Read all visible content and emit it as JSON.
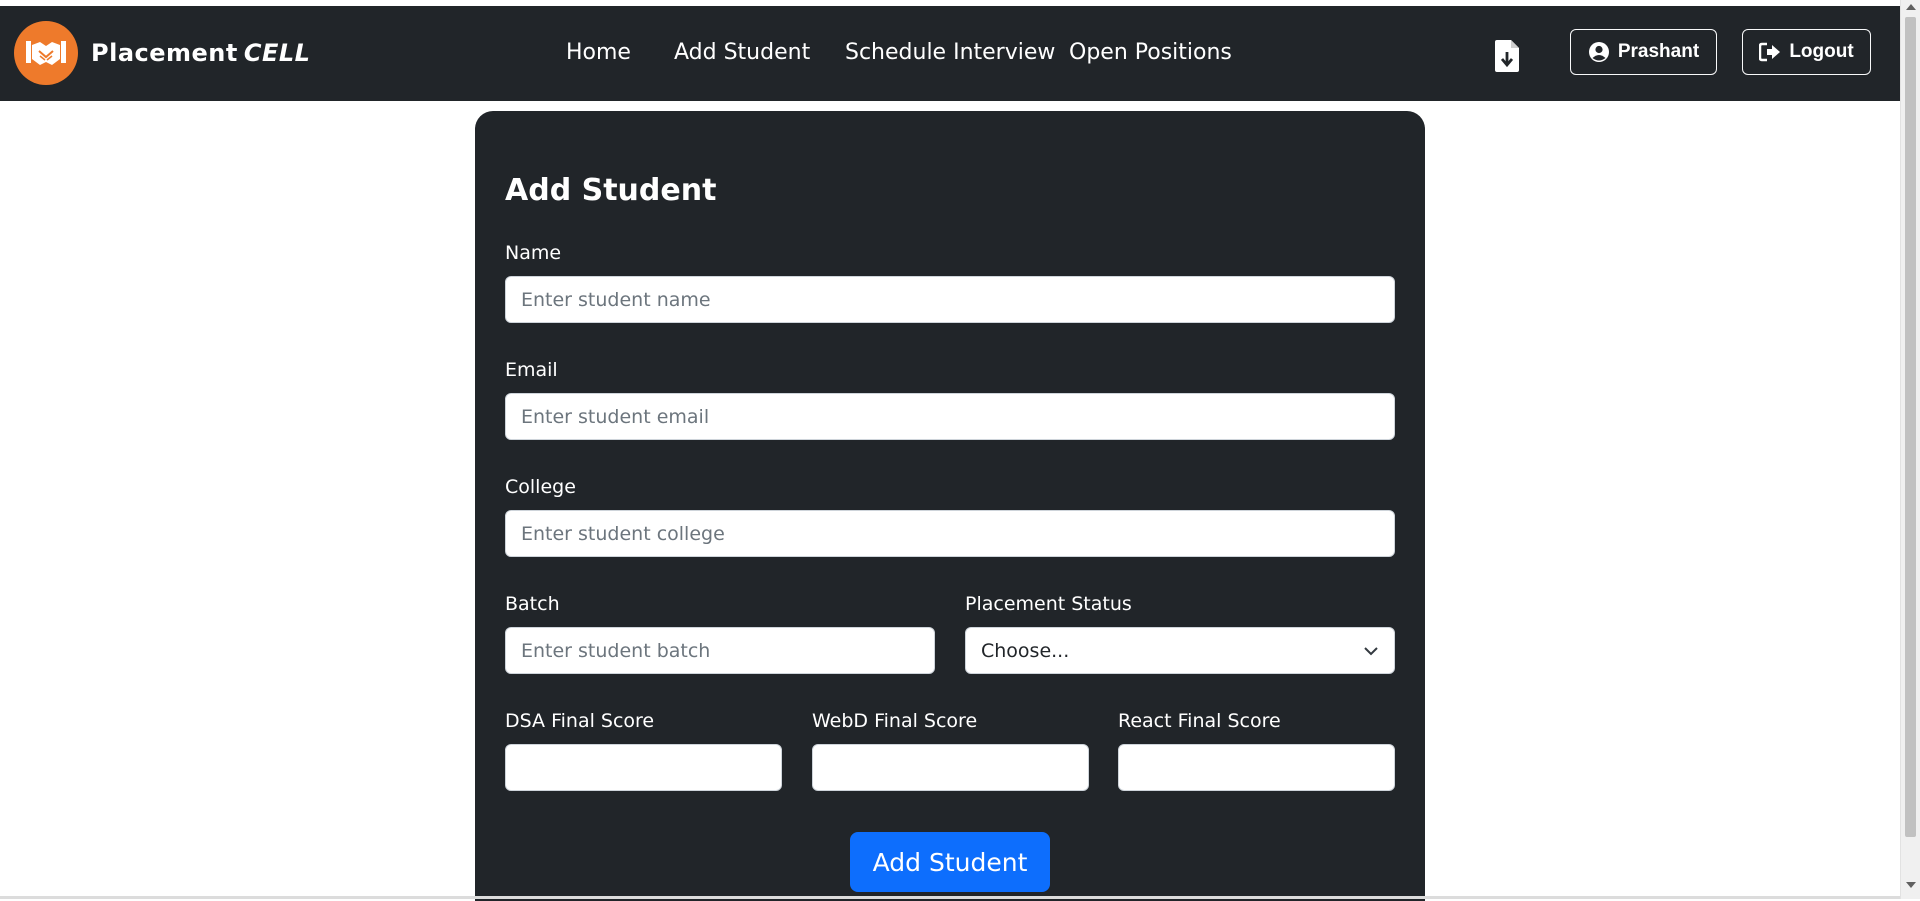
{
  "brand": {
    "name": "Placement",
    "accent": "CELL"
  },
  "nav": {
    "links": [
      {
        "label": "Home"
      },
      {
        "label": "Add Student"
      },
      {
        "label": "Schedule Interview"
      },
      {
        "label": "Open Positions"
      }
    ],
    "download_icon": "file-download-icon",
    "profile_label": "Prashant",
    "logout_label": "Logout"
  },
  "form": {
    "title": "Add Student",
    "name": {
      "label": "Name",
      "placeholder": "Enter student name"
    },
    "email": {
      "label": "Email",
      "placeholder": "Enter student email"
    },
    "college": {
      "label": "College",
      "placeholder": "Enter student college"
    },
    "batch": {
      "label": "Batch",
      "placeholder": "Enter student batch"
    },
    "placement_status": {
      "label": "Placement Status",
      "selected": "Choose..."
    },
    "dsa_score": {
      "label": "DSA Final Score",
      "placeholder": ""
    },
    "webd_score": {
      "label": "WebD Final Score",
      "placeholder": ""
    },
    "react_score": {
      "label": "React Final Score",
      "placeholder": ""
    },
    "submit_label": "Add Student"
  },
  "colors": {
    "navbar_bg": "#212529",
    "logo_orange": "#ee7a2b",
    "primary": "#0d6efd"
  }
}
